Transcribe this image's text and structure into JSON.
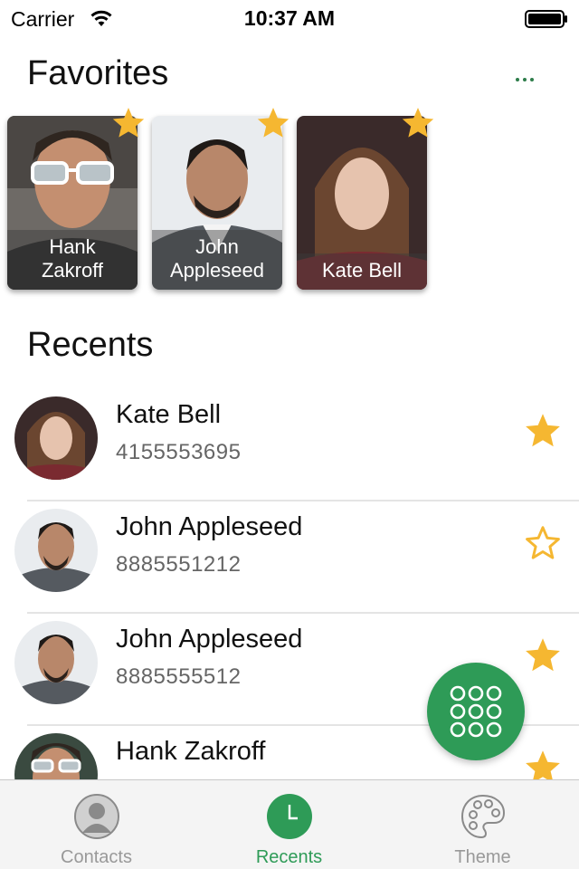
{
  "status_bar": {
    "carrier": "Carrier",
    "time": "10:37 AM"
  },
  "favorites": {
    "title": "Favorites",
    "items": [
      {
        "name": "Hank\nZakroff",
        "starred": true
      },
      {
        "name": "John\nAppleseed",
        "starred": true
      },
      {
        "name": "Kate Bell",
        "starred": true
      }
    ]
  },
  "recents": {
    "title": "Recents",
    "items": [
      {
        "name": "Kate Bell",
        "number": "4155553695",
        "starred": true
      },
      {
        "name": "John Appleseed",
        "number": "8885551212",
        "starred": false
      },
      {
        "name": "John Appleseed",
        "number": "8885555512",
        "starred": true
      },
      {
        "name": "Hank Zakroff",
        "number": "",
        "starred": true
      }
    ]
  },
  "tab_bar": {
    "tabs": [
      {
        "label": "Contacts",
        "icon": "person-icon",
        "active": false
      },
      {
        "label": "Recents",
        "icon": "clock-icon",
        "active": true
      },
      {
        "label": "Theme",
        "icon": "palette-icon",
        "active": false
      }
    ]
  },
  "colors": {
    "accent": "#2e9b57",
    "star": "#f5b731",
    "inactive_tab": "#999999"
  }
}
